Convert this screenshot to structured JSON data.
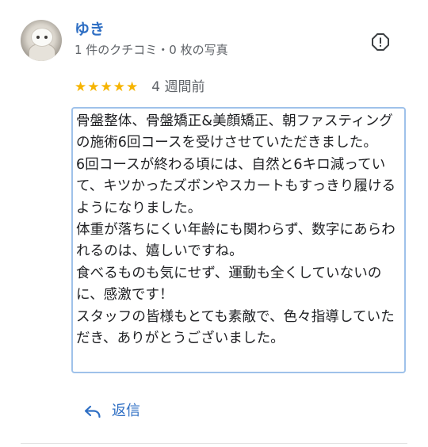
{
  "reviewer": {
    "name": "ゆき",
    "meta": "1 件のクチコミ・0 枚の写真"
  },
  "review": {
    "stars": [
      "★",
      "★",
      "★",
      "★",
      "★"
    ],
    "rating": 5,
    "date": "4 週間前",
    "text": "骨盤整体、骨盤矯正&美顔矯正、朝ファスティングの施術6回コースを受けさせていただきました。\n6回コースが終わる頃には、自然と6キロ減っていて、キツかったズボンやスカートもすっきり履けるようになりました。\n体重が落ちにくい年齢にも関わらず、数字にあらわれるのは、嬉しいですね。\n食べるものも気にせず、運動も全くしていないのに、感激です！\nスタッフの皆様もとても素敵で、色々指導していただき、ありがとうございました。"
  },
  "actions": {
    "reply_label": "返信"
  },
  "icons": {
    "report": "report-icon",
    "reply": "reply-icon"
  },
  "colors": {
    "name_blue": "#2f6fc4",
    "star_gold": "#f6b400",
    "meta_gray": "#5f6368",
    "box_border": "#9fc2ea"
  }
}
